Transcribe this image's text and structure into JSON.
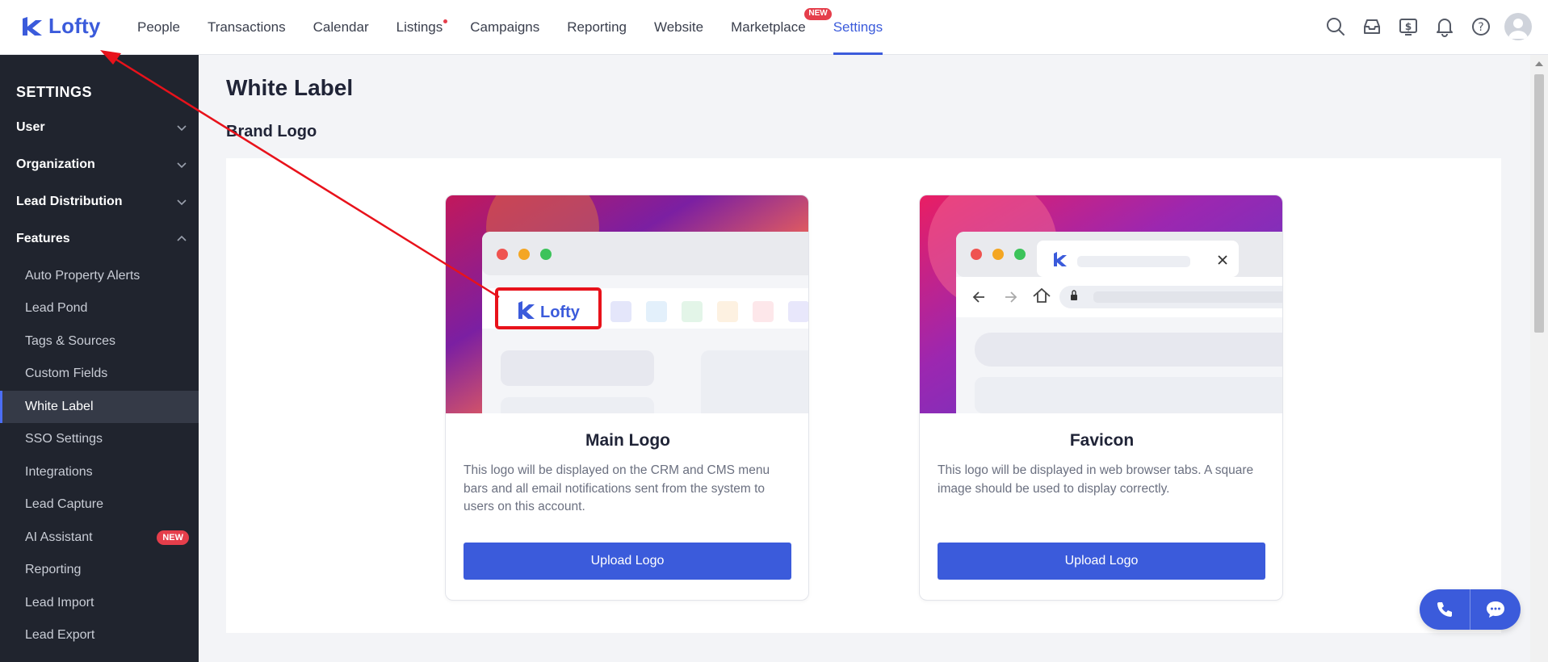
{
  "brand": {
    "name": "Lofty",
    "color": "#3b5bdb"
  },
  "nav": {
    "items": [
      {
        "label": "People"
      },
      {
        "label": "Transactions"
      },
      {
        "label": "Calendar"
      },
      {
        "label": "Listings"
      },
      {
        "label": "Campaigns"
      },
      {
        "label": "Reporting"
      },
      {
        "label": "Website"
      },
      {
        "label": "Marketplace",
        "badge": "NEW"
      },
      {
        "label": "Settings",
        "active": true
      }
    ],
    "icons": [
      "search-icon",
      "inbox-icon",
      "billing-icon",
      "bell-icon",
      "help-icon",
      "avatar"
    ]
  },
  "sidebar": {
    "title": "SETTINGS",
    "groups": [
      {
        "label": "User"
      },
      {
        "label": "Organization"
      },
      {
        "label": "Lead Distribution"
      },
      {
        "label": "Features"
      }
    ],
    "items": [
      {
        "label": "Auto Property Alerts"
      },
      {
        "label": "Lead Pond"
      },
      {
        "label": "Tags & Sources"
      },
      {
        "label": "Custom Fields"
      },
      {
        "label": "White Label",
        "active": true
      },
      {
        "label": "SSO Settings"
      },
      {
        "label": "Integrations"
      },
      {
        "label": "Lead Capture"
      },
      {
        "label": "AI Assistant",
        "badge": "NEW"
      },
      {
        "label": "Reporting"
      },
      {
        "label": "Lead Import"
      },
      {
        "label": "Lead Export"
      }
    ]
  },
  "main": {
    "title": "White Label",
    "section_title": "Brand Logo",
    "cards": [
      {
        "title": "Main Logo",
        "description": "This logo will be displayed on the CRM and CMS menu bars and all email notifications sent from the system to users on this account.",
        "button": "Upload Logo",
        "preview_logo": "Lofty"
      },
      {
        "title": "Favicon",
        "description": "This logo will be displayed in web browser tabs. A square image should be used to display correctly.",
        "button": "Upload Logo"
      }
    ]
  },
  "colors": {
    "accent": "#3b5bdb",
    "badge": "#e53e4b",
    "sidebar": "#20242e",
    "annotation": "#e8121b"
  }
}
